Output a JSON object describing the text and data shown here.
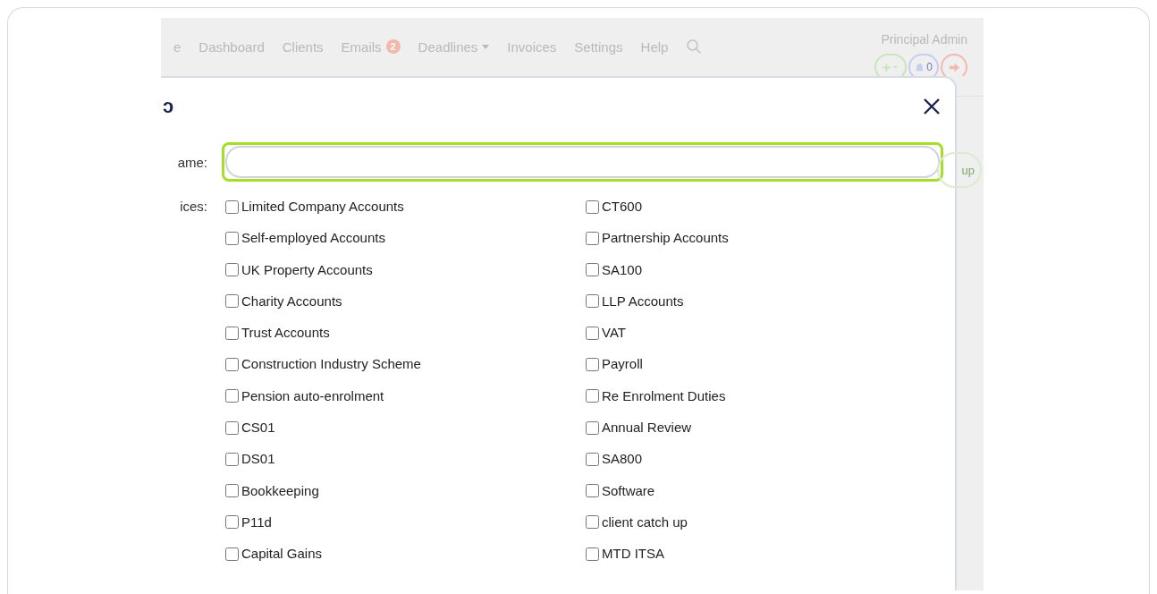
{
  "navbar": {
    "items": [
      {
        "label": "e"
      },
      {
        "label": "Dashboard"
      },
      {
        "label": "Clients"
      },
      {
        "label": "Emails",
        "badge": "2"
      },
      {
        "label": "Deadlines",
        "dropdown": true
      },
      {
        "label": "Invoices"
      },
      {
        "label": "Settings"
      },
      {
        "label": "Help"
      }
    ],
    "user": {
      "name": "Principal Admin",
      "notifications": "0"
    }
  },
  "background_button": {
    "label": "up"
  },
  "modal": {
    "title": "ɔ",
    "name_label": "ame:",
    "services_label": "ices:",
    "services": [
      {
        "label": "Limited Company Accounts",
        "checked": false
      },
      {
        "label": "CT600",
        "checked": false
      },
      {
        "label": "Self-employed Accounts",
        "checked": false
      },
      {
        "label": "Partnership Accounts",
        "checked": false
      },
      {
        "label": "UK Property Accounts",
        "checked": false
      },
      {
        "label": "SA100",
        "checked": false
      },
      {
        "label": "Charity Accounts",
        "checked": false
      },
      {
        "label": "LLP Accounts",
        "checked": false
      },
      {
        "label": "Trust Accounts",
        "checked": false
      },
      {
        "label": "VAT",
        "checked": false
      },
      {
        "label": "Construction Industry Scheme",
        "checked": false
      },
      {
        "label": "Payroll",
        "checked": false
      },
      {
        "label": "Pension auto-enrolment",
        "checked": false
      },
      {
        "label": "Re Enrolment Duties",
        "checked": false
      },
      {
        "label": "CS01",
        "checked": false
      },
      {
        "label": "Annual Review",
        "checked": false
      },
      {
        "label": "DS01",
        "checked": false
      },
      {
        "label": "SA800",
        "checked": false
      },
      {
        "label": "Bookkeeping",
        "checked": false
      },
      {
        "label": "Software",
        "checked": false
      },
      {
        "label": "P11d",
        "checked": false
      },
      {
        "label": "client catch up",
        "checked": false
      },
      {
        "label": "Capital Gains",
        "checked": false
      },
      {
        "label": "MTD ITSA",
        "checked": false
      }
    ]
  }
}
